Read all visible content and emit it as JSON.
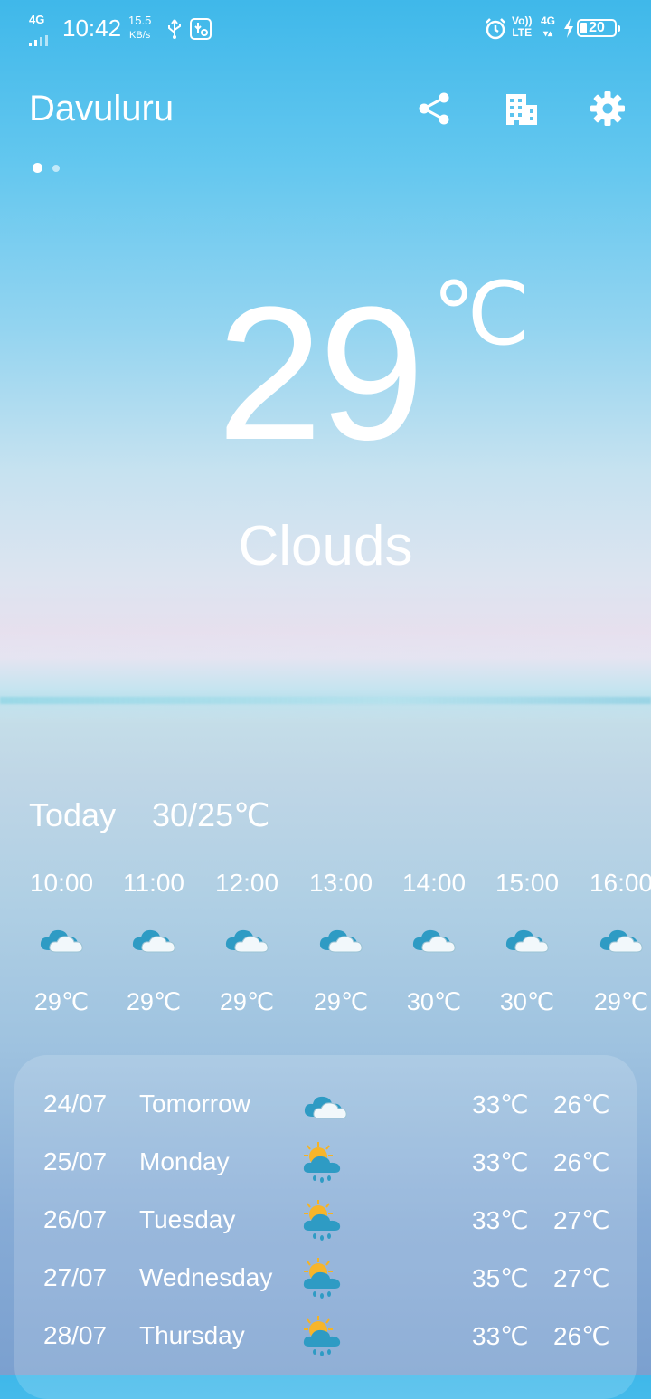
{
  "status_bar": {
    "network_type": "4G",
    "time": "10:42",
    "speed_value": "15.5",
    "speed_unit": "KB/s",
    "volte_top": "Vo))",
    "volte_bottom": "LTE",
    "net2": "4G",
    "battery_level": "20"
  },
  "header": {
    "city": "Davuluru",
    "icons": [
      "share-icon",
      "city-icon",
      "settings-icon"
    ]
  },
  "current": {
    "temperature": "29",
    "unit": "℃",
    "condition": "Clouds"
  },
  "today": {
    "label": "Today",
    "range": "30/25℃"
  },
  "hourly": [
    {
      "time": "10:00",
      "icon": "cloud-icon",
      "temp": "29℃"
    },
    {
      "time": "11:00",
      "icon": "cloud-icon",
      "temp": "29℃"
    },
    {
      "time": "12:00",
      "icon": "cloud-icon",
      "temp": "29℃"
    },
    {
      "time": "13:00",
      "icon": "cloud-icon",
      "temp": "29℃"
    },
    {
      "time": "14:00",
      "icon": "cloud-icon",
      "temp": "30℃"
    },
    {
      "time": "15:00",
      "icon": "cloud-icon",
      "temp": "30℃"
    },
    {
      "time": "16:00",
      "icon": "cloud-icon",
      "temp": "29℃"
    }
  ],
  "forecast": [
    {
      "date": "24/07",
      "day": "Tomorrow",
      "icon": "cloud-icon",
      "high": "33℃",
      "low": "26℃"
    },
    {
      "date": "25/07",
      "day": "Monday",
      "icon": "sun-rain-icon",
      "high": "33℃",
      "low": "26℃"
    },
    {
      "date": "26/07",
      "day": "Tuesday",
      "icon": "sun-rain-icon",
      "high": "33℃",
      "low": "27℃"
    },
    {
      "date": "27/07",
      "day": "Wednesday",
      "icon": "sun-rain-icon",
      "high": "35℃",
      "low": "27℃"
    },
    {
      "date": "28/07",
      "day": "Thursday",
      "icon": "sun-rain-icon",
      "high": "33℃",
      "low": "26℃"
    }
  ]
}
